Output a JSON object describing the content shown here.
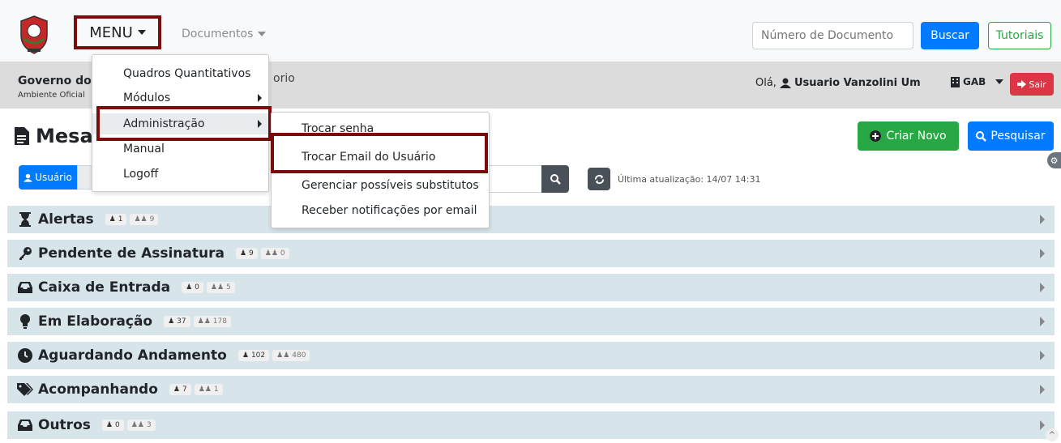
{
  "topbar": {
    "menu_label": "MENU",
    "documents_label": "Documentos",
    "search_placeholder": "Número de Documento",
    "buscar_label": "Buscar",
    "tutoriais_label": "Tutoriais"
  },
  "header": {
    "org_name": "Governo do",
    "org_sub": "Ambiente Oficial",
    "org_rest": "orio",
    "hello_prefix": "Olá,",
    "user_name": "Usuario Vanzolini Um",
    "unit": "GAB",
    "sair_label": "Sair"
  },
  "page": {
    "title": "Mesa",
    "criar_label": "Criar Novo",
    "pesquisar_label": "Pesquisar",
    "tab_usuario": "Usuário",
    "last_update": "Última atualização: 14/07 14:31"
  },
  "menu": {
    "items": [
      {
        "label": "Quadros Quantitativos"
      },
      {
        "label": "Módulos"
      },
      {
        "label": "Administração"
      },
      {
        "label": "Manual"
      },
      {
        "label": "Logoff"
      }
    ]
  },
  "submenu": {
    "items": [
      {
        "label": "Trocar senha"
      },
      {
        "label": "Trocar Email do Usuário"
      },
      {
        "label": "Gerenciar possíveis substitutos"
      },
      {
        "label": "Receber notificações por email"
      }
    ]
  },
  "categories": [
    {
      "label": "Alertas",
      "user": "1",
      "group": "9",
      "icon": "hourglass-icon"
    },
    {
      "label": "Pendente de Assinatura",
      "user": "9",
      "group": "0",
      "icon": "key-icon"
    },
    {
      "label": "Caixa de Entrada",
      "user": "0",
      "group": "5",
      "icon": "inbox-icon"
    },
    {
      "label": "Em Elaboração",
      "user": "37",
      "group": "178",
      "icon": "lightbulb-icon"
    },
    {
      "label": "Aguardando Andamento",
      "user": "102",
      "group": "480",
      "icon": "clock-icon"
    },
    {
      "label": "Acompanhando",
      "user": "7",
      "group": "1",
      "icon": "tags-icon"
    },
    {
      "label": "Outros",
      "user": "0",
      "group": "3",
      "icon": "inbox-icon"
    }
  ],
  "colors": {
    "primary": "#007bff",
    "success": "#28a745",
    "danger": "#dc3545",
    "highlight": "#7a0c0c",
    "row_bg": "#d7e5ea"
  }
}
